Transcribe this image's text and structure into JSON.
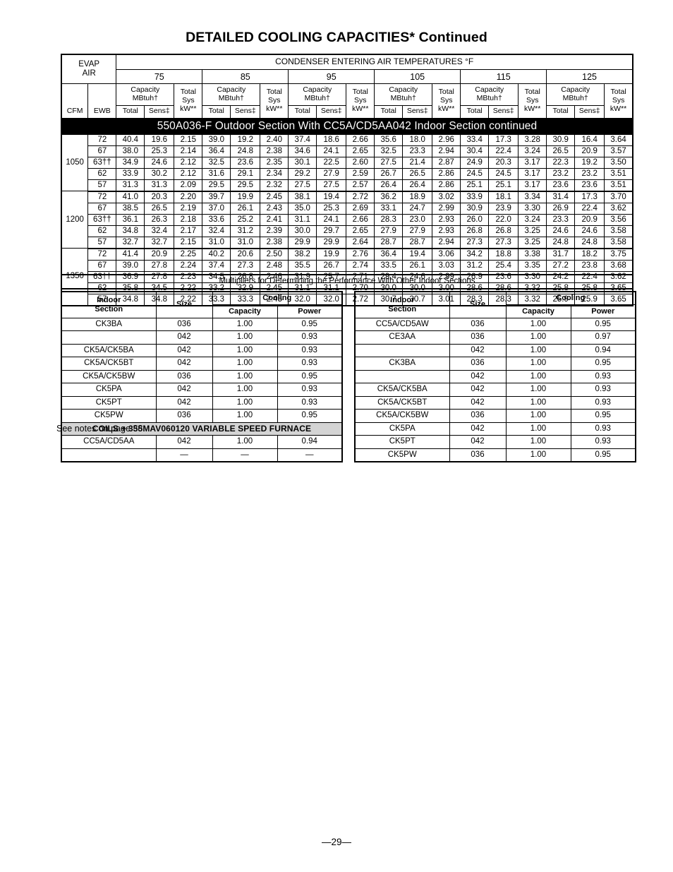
{
  "document": {
    "title": "DETAILED COOLING CAPACITIES* Continued",
    "see_notes": "See notes on page 38.",
    "page_number": "—29—"
  },
  "capacity_table": {
    "evap_air_label_line1": "EVAP",
    "evap_air_label_line2": "AIR",
    "condenser_header": "CONDENSER ENTERING AIR TEMPERATURES °F",
    "temperatures": [
      "75",
      "85",
      "95",
      "105",
      "115",
      "125"
    ],
    "group_header": "Capacity",
    "group_header2": "MBtuh†",
    "total_sys_line1": "Total",
    "total_sys_line2": "Sys",
    "total_sys_line3": "kW**",
    "col_cfm": "CFM",
    "col_ewb": "EWB",
    "col_total": "Total",
    "col_sens": "Sens‡",
    "col_kw": "kW**",
    "banner": "550A036-F Outdoor Section With CC5A/CD5AA042 Indoor Section continued",
    "blocks": [
      {
        "cfm": "1050",
        "rows": [
          {
            "ewb": "72",
            "v": [
              "40.4",
              "19.6",
              "2.15",
              "39.0",
              "19.2",
              "2.40",
              "37.4",
              "18.6",
              "2.66",
              "35.6",
              "18.0",
              "2.96",
              "33.4",
              "17.3",
              "3.28",
              "30.9",
              "16.4",
              "3.64"
            ]
          },
          {
            "ewb": "67",
            "v": [
              "38.0",
              "25.3",
              "2.14",
              "36.4",
              "24.8",
              "2.38",
              "34.6",
              "24.1",
              "2.65",
              "32.5",
              "23.3",
              "2.94",
              "30.4",
              "22.4",
              "3.24",
              "26.5",
              "20.9",
              "3.57"
            ]
          },
          {
            "ewb": "63††",
            "v": [
              "34.9",
              "24.6",
              "2.12",
              "32.5",
              "23.6",
              "2.35",
              "30.1",
              "22.5",
              "2.60",
              "27.5",
              "21.4",
              "2.87",
              "24.9",
              "20.3",
              "3.17",
              "22.3",
              "19.2",
              "3.50"
            ]
          },
          {
            "ewb": "62",
            "v": [
              "33.9",
              "30.2",
              "2.12",
              "31.6",
              "29.1",
              "2.34",
              "29.2",
              "27.9",
              "2.59",
              "26.7",
              "26.5",
              "2.86",
              "24.5",
              "24.5",
              "3.17",
              "23.2",
              "23.2",
              "3.51"
            ]
          },
          {
            "ewb": "57",
            "v": [
              "31.3",
              "31.3",
              "2.09",
              "29.5",
              "29.5",
              "2.32",
              "27.5",
              "27.5",
              "2.57",
              "26.4",
              "26.4",
              "2.86",
              "25.1",
              "25.1",
              "3.17",
              "23.6",
              "23.6",
              "3.51"
            ]
          }
        ]
      },
      {
        "cfm": "1200",
        "rows": [
          {
            "ewb": "72",
            "v": [
              "41.0",
              "20.3",
              "2.20",
              "39.7",
              "19.9",
              "2.45",
              "38.1",
              "19.4",
              "2.72",
              "36.2",
              "18.9",
              "3.02",
              "33.9",
              "18.1",
              "3.34",
              "31.4",
              "17.3",
              "3.70"
            ]
          },
          {
            "ewb": "67",
            "v": [
              "38.5",
              "26.5",
              "2.19",
              "37.0",
              "26.1",
              "2.43",
              "35.0",
              "25.3",
              "2.69",
              "33.1",
              "24.7",
              "2.99",
              "30.9",
              "23.9",
              "3.30",
              "26.9",
              "22.4",
              "3.62"
            ]
          },
          {
            "ewb": "63††",
            "v": [
              "36.1",
              "26.3",
              "2.18",
              "33.6",
              "25.2",
              "2.41",
              "31.1",
              "24.1",
              "2.66",
              "28.3",
              "23.0",
              "2.93",
              "26.0",
              "22.0",
              "3.24",
              "23.3",
              "20.9",
              "3.56"
            ]
          },
          {
            "ewb": "62",
            "v": [
              "34.8",
              "32.4",
              "2.17",
              "32.4",
              "31.2",
              "2.39",
              "30.0",
              "29.7",
              "2.65",
              "27.9",
              "27.9",
              "2.93",
              "26.8",
              "26.8",
              "3.25",
              "24.6",
              "24.6",
              "3.58"
            ]
          },
          {
            "ewb": "57",
            "v": [
              "32.7",
              "32.7",
              "2.15",
              "31.0",
              "31.0",
              "2.38",
              "29.9",
              "29.9",
              "2.64",
              "28.7",
              "28.7",
              "2.94",
              "27.3",
              "27.3",
              "3.25",
              "24.8",
              "24.8",
              "3.58"
            ]
          }
        ]
      },
      {
        "cfm": "1350",
        "rows": [
          {
            "ewb": "72",
            "v": [
              "41.4",
              "20.9",
              "2.25",
              "40.2",
              "20.6",
              "2.50",
              "38.2",
              "19.9",
              "2.76",
              "36.4",
              "19.4",
              "3.06",
              "34.2",
              "18.8",
              "3.38",
              "31.7",
              "18.2",
              "3.75"
            ]
          },
          {
            "ewb": "67",
            "v": [
              "39.0",
              "27.8",
              "2.24",
              "37.4",
              "27.3",
              "2.48",
              "35.5",
              "26.7",
              "2.74",
              "33.5",
              "26.1",
              "3.03",
              "31.2",
              "25.4",
              "3.35",
              "27.2",
              "23.8",
              "3.68"
            ]
          },
          {
            "ewb": "63††",
            "v": [
              "36.9",
              "27.8",
              "2.23",
              "34.5",
              "26.8",
              "2.46",
              "31.9",
              "25.7",
              "2.71",
              "29.4",
              "24.6",
              "2.99",
              "26.9",
              "23.6",
              "3.30",
              "24.2",
              "22.4",
              "3.62"
            ]
          },
          {
            "ewb": "62",
            "v": [
              "35.8",
              "34.5",
              "2.22",
              "33.2",
              "32.9",
              "2.45",
              "31.1",
              "31.1",
              "2.70",
              "30.0",
              "30.0",
              "3.00",
              "28.6",
              "28.6",
              "3.32",
              "25.8",
              "25.8",
              "3.65"
            ]
          },
          {
            "ewb": "57",
            "v": [
              "34.8",
              "34.8",
              "2.22",
              "33.3",
              "33.3",
              "2.45",
              "32.0",
              "32.0",
              "2.72",
              "30.7",
              "30.7",
              "3.01",
              "28.3",
              "28.3",
              "3.32",
              "25.9",
              "25.9",
              "3.65"
            ]
          }
        ]
      }
    ]
  },
  "multipliers": {
    "title": "Multipliers for Determining the Performance With Other Indoor Sections",
    "head_indoor_line1": "Indoor",
    "head_indoor_line2": "Section",
    "head_size": "Size",
    "head_cooling": "Cooling",
    "head_capacity": "Capacity",
    "head_power": "Power",
    "coils_band": "COILS + 355MAV060120 VARIABLE SPEED FURNACE",
    "left_rows": [
      {
        "section": "CK3BA",
        "size": "036",
        "capacity": "1.00",
        "power": "0.95"
      },
      {
        "section": "",
        "size": "042",
        "capacity": "1.00",
        "power": "0.93"
      },
      {
        "section": "CK5A/CK5BA",
        "size": "042",
        "capacity": "1.00",
        "power": "0.93"
      },
      {
        "section": "CK5A/CK5BT",
        "size": "042",
        "capacity": "1.00",
        "power": "0.93"
      },
      {
        "section": "CK5A/CK5BW",
        "size": "036",
        "capacity": "1.00",
        "power": "0.95"
      },
      {
        "section": "CK5PA",
        "size": "042",
        "capacity": "1.00",
        "power": "0.93"
      },
      {
        "section": "CK5PT",
        "size": "042",
        "capacity": "1.00",
        "power": "0.93"
      },
      {
        "section": "CK5PW",
        "size": "036",
        "capacity": "1.00",
        "power": "0.95"
      }
    ],
    "left_rows_after_band": [
      {
        "section": "CC5A/CD5AA",
        "size": "042",
        "capacity": "1.00",
        "power": "0.94"
      },
      {
        "section": "",
        "size": "—",
        "capacity": "—",
        "power": "—"
      }
    ],
    "right_rows": [
      {
        "section": "CC5A/CD5AW",
        "size": "036",
        "capacity": "1.00",
        "power": "0.95"
      },
      {
        "section": "CE3AA",
        "size": "036",
        "capacity": "1.00",
        "power": "0.97"
      },
      {
        "section": "",
        "size": "042",
        "capacity": "1.00",
        "power": "0.94"
      },
      {
        "section": "CK3BA",
        "size": "036",
        "capacity": "1.00",
        "power": "0.95"
      },
      {
        "section": "",
        "size": "042",
        "capacity": "1.00",
        "power": "0.93"
      },
      {
        "section": "CK5A/CK5BA",
        "size": "042",
        "capacity": "1.00",
        "power": "0.93"
      },
      {
        "section": "CK5A/CK5BT",
        "size": "042",
        "capacity": "1.00",
        "power": "0.93"
      },
      {
        "section": "CK5A/CK5BW",
        "size": "036",
        "capacity": "1.00",
        "power": "0.95"
      },
      {
        "section": "CK5PA",
        "size": "042",
        "capacity": "1.00",
        "power": "0.93"
      },
      {
        "section": "CK5PT",
        "size": "042",
        "capacity": "1.00",
        "power": "0.93"
      },
      {
        "section": "CK5PW",
        "size": "036",
        "capacity": "1.00",
        "power": "0.95"
      }
    ]
  }
}
